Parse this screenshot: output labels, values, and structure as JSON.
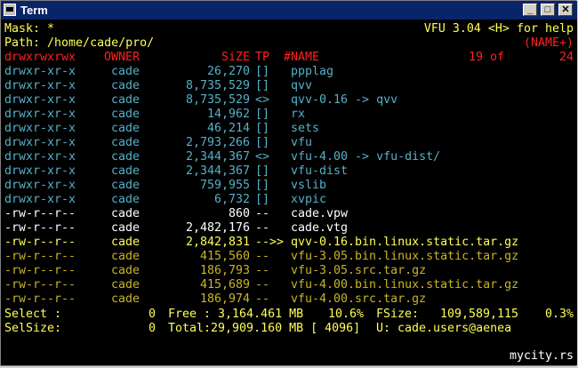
{
  "window": {
    "title": "Term"
  },
  "header": {
    "mask_label": "Mask: *",
    "help_label": "VFU 3.04 <H> for help",
    "path_label": "Path: /home/cade/pro/",
    "sort_label": "(NAME+)"
  },
  "columns": {
    "mode": "drwxrwxrwx",
    "owner": "OWNER",
    "size": "SiZE",
    "type": "TP",
    "name": "#NAME",
    "position": "19 of",
    "total": "24"
  },
  "files": [
    {
      "mode": "drwxr-xr-x",
      "owner": "cade",
      "size": "26,270",
      "type": "[]",
      "name": "ppplag",
      "kind": "dir"
    },
    {
      "mode": "drwxr-xr-x",
      "owner": "cade",
      "size": "8,735,529",
      "type": "[]",
      "name": "qvv",
      "kind": "dir"
    },
    {
      "mode": "drwxr-xr-x",
      "owner": "cade",
      "size": "8,735,529",
      "type": "<>",
      "name": "qvv-0.16 -> qvv",
      "kind": "dir"
    },
    {
      "mode": "drwxr-xr-x",
      "owner": "cade",
      "size": "14,962",
      "type": "[]",
      "name": "rx",
      "kind": "dir"
    },
    {
      "mode": "drwxr-xr-x",
      "owner": "cade",
      "size": "46,214",
      "type": "[]",
      "name": "sets",
      "kind": "dir"
    },
    {
      "mode": "drwxr-xr-x",
      "owner": "cade",
      "size": "2,793,266",
      "type": "[]",
      "name": "vfu",
      "kind": "dir"
    },
    {
      "mode": "drwxr-xr-x",
      "owner": "cade",
      "size": "2,344,367",
      "type": "<>",
      "name": "vfu-4.00 -> vfu-dist/",
      "kind": "dir"
    },
    {
      "mode": "drwxr-xr-x",
      "owner": "cade",
      "size": "2,344,367",
      "type": "[]",
      "name": "vfu-dist",
      "kind": "dir"
    },
    {
      "mode": "drwxr-xr-x",
      "owner": "cade",
      "size": "759,955",
      "type": "[]",
      "name": "vslib",
      "kind": "dir"
    },
    {
      "mode": "drwxr-xr-x",
      "owner": "cade",
      "size": "6,732",
      "type": "[]",
      "name": "xvpic",
      "kind": "dir"
    },
    {
      "mode": "-rw-r--r--",
      "owner": "cade",
      "size": "860",
      "type": "--",
      "name": "cade.vpw",
      "kind": "file"
    },
    {
      "mode": "-rw-r--r--",
      "owner": "cade",
      "size": "2,482,176",
      "type": "--",
      "name": "cade.vtg",
      "kind": "file"
    },
    {
      "mode": "-rw-r--r--",
      "owner": "cade",
      "size": "2,842,831",
      "type": "-->>",
      "name": "qvv-0.16.bin.linux.static.tar.gz",
      "kind": "current"
    },
    {
      "mode": "-rw-r--r--",
      "owner": "cade",
      "size": "415,560",
      "type": "--",
      "name": "vfu-3.05.bin.linux.static.tar.gz",
      "kind": "archive"
    },
    {
      "mode": "-rw-r--r--",
      "owner": "cade",
      "size": "186,793",
      "type": "--",
      "name": "vfu-3.05.src.tar.gz",
      "kind": "archive"
    },
    {
      "mode": "-rw-r--r--",
      "owner": "cade",
      "size": "415,689",
      "type": "--",
      "name": "vfu-4.00.bin.linux.static.tar.gz",
      "kind": "archive"
    },
    {
      "mode": "-rw-r--r--",
      "owner": "cade",
      "size": "186,974",
      "type": "--",
      "name": "vfu-4.00.src.tar.gz",
      "kind": "archive"
    }
  ],
  "status": {
    "select_label": "Select :",
    "select_value": "0",
    "free_label": "Free : 3,164.461 MB",
    "free_percent": "10.6%",
    "fsize_label": "FSize:",
    "fsize_value": "109,589,115",
    "fsize_percent": "0.3%",
    "selsize_label": "SelSize:",
    "selsize_value": "0",
    "total_label": "Total:29,909.160 MB [ 4096]",
    "user_label": "U: cade.users@aenea"
  },
  "footer": {
    "text": "mycity.rs"
  },
  "colors": {
    "titlebar": "#0a246a",
    "yellow": "#ffff55",
    "cyan": "#55b0c8",
    "red": "#ff2020",
    "white": "#ffffff",
    "gold": "#c8b428"
  }
}
